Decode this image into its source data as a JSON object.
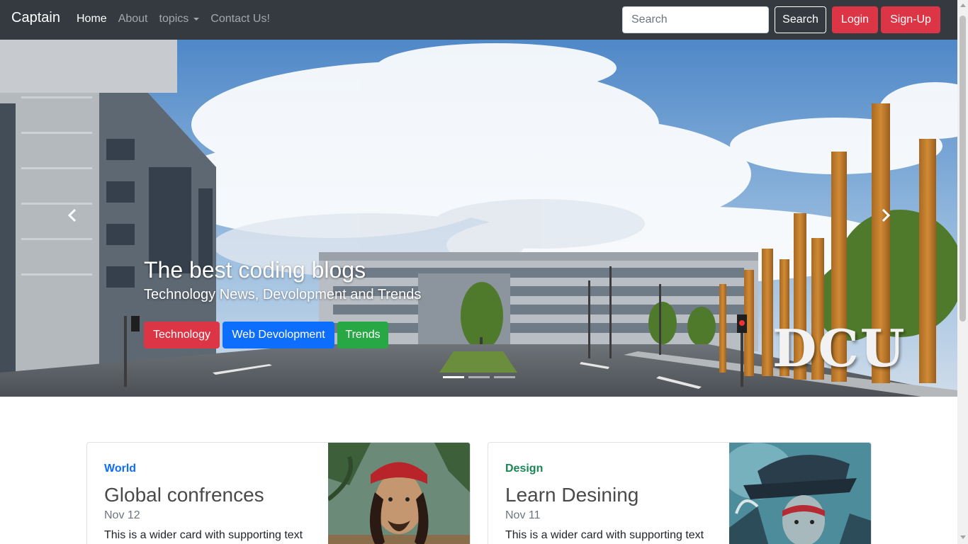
{
  "navbar": {
    "brand": "Captain",
    "links": [
      {
        "label": "Home"
      },
      {
        "label": "About"
      },
      {
        "label": "topics"
      },
      {
        "label": "Contact Us!"
      }
    ],
    "search_placeholder": "Search",
    "search_button": "Search",
    "login_button": "Login",
    "signup_button": "Sign-Up"
  },
  "hero": {
    "title": "The best coding blogs",
    "subtitle": "Technology News, Devolopment and Trends",
    "buttons": [
      {
        "label": "Technology"
      },
      {
        "label": "Web Devolopment"
      },
      {
        "label": "Trends"
      }
    ],
    "sign_text": "DCU",
    "indicators": 3,
    "active_indicator": 1
  },
  "cards": [
    {
      "category": "World",
      "title": "Global confrences",
      "date": "Nov 12",
      "text": "This is a wider card with supporting text"
    },
    {
      "category": "Design",
      "title": "Learn Desining",
      "date": "Nov 11",
      "text": "This is a wider card with supporting text"
    }
  ],
  "colors": {
    "navbar_bg": "#343a40",
    "danger": "#dc3545",
    "primary": "#0d6efd",
    "success": "#28a745"
  }
}
